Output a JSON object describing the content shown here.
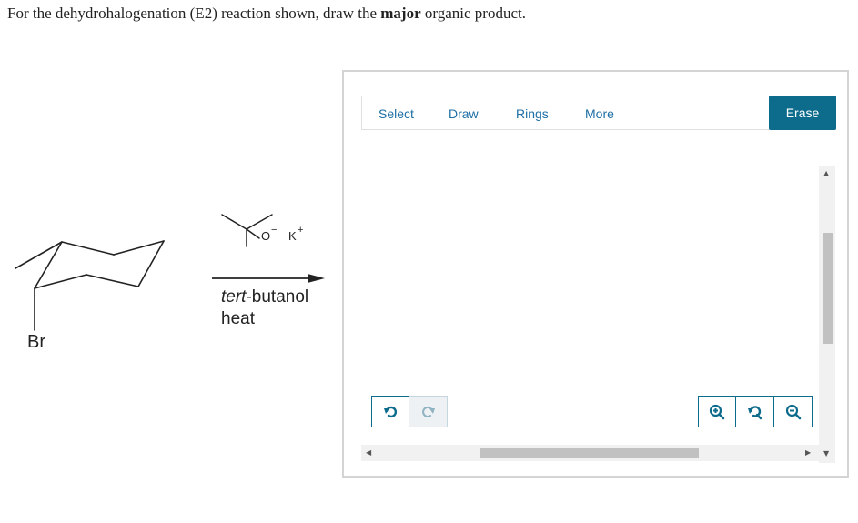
{
  "question": {
    "prefix": "For the dehydrohalogenation (E2) reaction shown, draw the ",
    "emphasis": "major",
    "suffix": " organic product."
  },
  "reaction": {
    "substituent_label": "Br",
    "reagent_anion": "O",
    "reagent_anion_charge": "−",
    "reagent_cation": "K",
    "reagent_cation_charge": "+",
    "solvent_prefix": "tert",
    "solvent_suffix": "-butanol",
    "condition": "heat"
  },
  "sketcher": {
    "toolbar": {
      "select": "Select",
      "draw": "Draw",
      "rings": "Rings",
      "more": "More",
      "erase": "Erase"
    },
    "undo_icon": "undo-icon",
    "redo_icon": "redo-icon",
    "zoom_in_icon": "zoom-in-icon",
    "zoom_reset_icon": "zoom-reset-icon",
    "zoom_out_icon": "zoom-out-icon",
    "accent_color": "#0d6b8c",
    "link_color": "#1d6fa5"
  }
}
